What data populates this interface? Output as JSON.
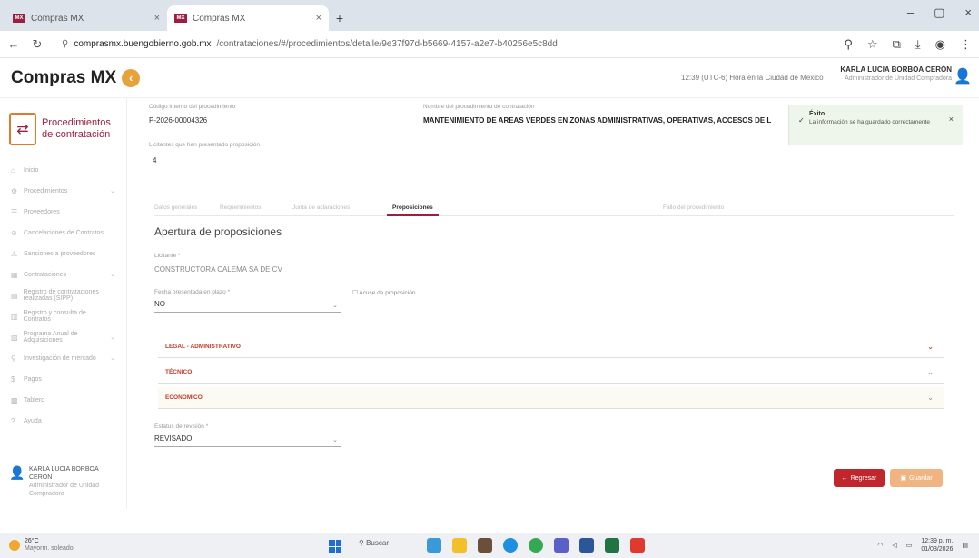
{
  "browser": {
    "tabs": [
      {
        "favicon": "MX",
        "label": "Compras MX",
        "active": false
      },
      {
        "favicon": "MX",
        "label": "Compras MX",
        "active": true
      }
    ],
    "url_host": "comprasmx.buengobierno.gob.mx",
    "url_path": "/contrataciones/#/procedimientos/detalle/9e37f97d-b5669-4157-a2e7-b40256e5c8dd"
  },
  "app": {
    "logo_text": "Compras MX",
    "clock": "12:39 (UTC-6) Hora en la Ciudad de México",
    "user_name": "KARLA LUCIA BORBOA CERÓN",
    "user_role": "Administrador de Unidad Compradora"
  },
  "sidebar": {
    "module_title_1": "Procedimientos",
    "module_title_2": "de contratación",
    "items": [
      {
        "label": "Inicio",
        "chev": ""
      },
      {
        "label": "Procedimientos",
        "chev": "⌄"
      },
      {
        "label": "Proveedores",
        "chev": ""
      },
      {
        "label": "Cancelaciones de Contratos",
        "chev": ""
      },
      {
        "label": "Sanciones a proveedores",
        "chev": ""
      },
      {
        "label": "Contrataciones",
        "chev": "⌄"
      },
      {
        "label": "Registro de contrataciones realizadas (SIPP)",
        "chev": ""
      },
      {
        "label": "Registro y consulta de Contratos",
        "chev": ""
      },
      {
        "label": "Programa Anual de Adquisiciones",
        "chev": "⌄"
      },
      {
        "label": "Investigación de mercado",
        "chev": "⌄"
      },
      {
        "label": "Pagos",
        "chev": ""
      },
      {
        "label": "Tablero",
        "chev": ""
      },
      {
        "label": "Ayuda",
        "chev": ""
      }
    ],
    "user_name": "KARLA LUCIA BORBOA CERÓN",
    "user_role": "Administrador de Unidad Compradora"
  },
  "form": {
    "code_label": "Código interno del procedimiento",
    "code_value": "P-2026-00004326",
    "name_label": "Nombre del procedimiento de contratación",
    "name_value": "MANTENIMIENTO DE AREAS VERDES EN ZONAS ADMINISTRATIVAS, OPERATIVAS, ACCESOS DE L",
    "proposals_label": "Licitantes que han presentado proposición",
    "proposals_value": "4",
    "tabs": [
      {
        "label": "Datos generales"
      },
      {
        "label": "Requerimientos"
      },
      {
        "label": "Junta de aclaraciones"
      },
      {
        "label": "Proposiciones"
      },
      {
        "label": "Fallo del procedimiento"
      }
    ],
    "section_title": "Apertura de proposiciones",
    "bidder_label": "Licitante *",
    "bidder_value": "CONSTRUCTORA CALEMA SA DE CV",
    "late_label": "Fecha presentada en plazo *",
    "late_value": "NO",
    "check_link": "Acuse de proposición",
    "sections": [
      {
        "label": "LEGAL - ADMINISTRATIVO"
      },
      {
        "label": "TÉCNICO"
      },
      {
        "label": "ECONÓMICO"
      }
    ],
    "status_label": "Estatus de revisión *",
    "status_value": "REVISADO",
    "back_button": "Regresar",
    "save_button": "Guardar"
  },
  "toast": {
    "title": "Éxito",
    "message": "La información se ha guardado correctamente"
  },
  "taskbar": {
    "temp": "26°C",
    "weather_desc": "Mayorm. soleado",
    "search": "Buscar",
    "time": "12:39 p. m.",
    "date": "01/03/2026"
  },
  "colors": {
    "brand": "#9a1f40",
    "accent_red": "#c0272d",
    "accent_orange": "#e8a23a"
  }
}
